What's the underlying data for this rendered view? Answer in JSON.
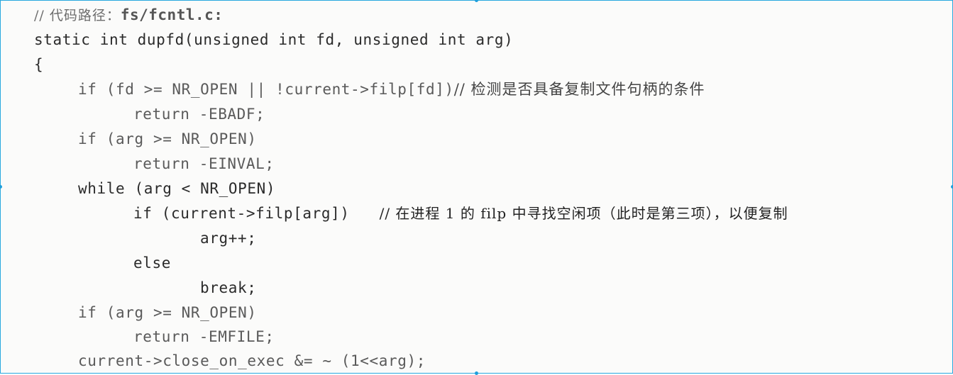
{
  "header": {
    "comment_prefix": "// 代码路径：",
    "path": "fs/fcntl.c:"
  },
  "lines": [
    {
      "code": "static int dupfd(unsigned int fd, unsigned int arg)",
      "comment": ""
    },
    {
      "code": "{",
      "comment": ""
    },
    {
      "code": "if (fd >= NR_OPEN || !current->filp[fd])",
      "comment": "// 检测是否具备复制文件句柄的条件"
    },
    {
      "code": "return -EBADF;",
      "comment": ""
    },
    {
      "code": "if (arg >= NR_OPEN)",
      "comment": ""
    },
    {
      "code": "return -EINVAL;",
      "comment": ""
    },
    {
      "code": "while (arg < NR_OPEN)",
      "comment": ""
    },
    {
      "code": "if (current->filp[arg])",
      "comment": "// 在进程 1 的 filp 中寻找空闲项（此时是第三项），以便复制"
    },
    {
      "code": "arg++;",
      "comment": ""
    },
    {
      "code": "else",
      "comment": ""
    },
    {
      "code": "break;",
      "comment": ""
    },
    {
      "code": "if (arg >= NR_OPEN)",
      "comment": ""
    },
    {
      "code": "return -EMFILE;",
      "comment": ""
    },
    {
      "code": "current->close_on_exec &= ~ (1<<arg);",
      "comment": ""
    }
  ]
}
